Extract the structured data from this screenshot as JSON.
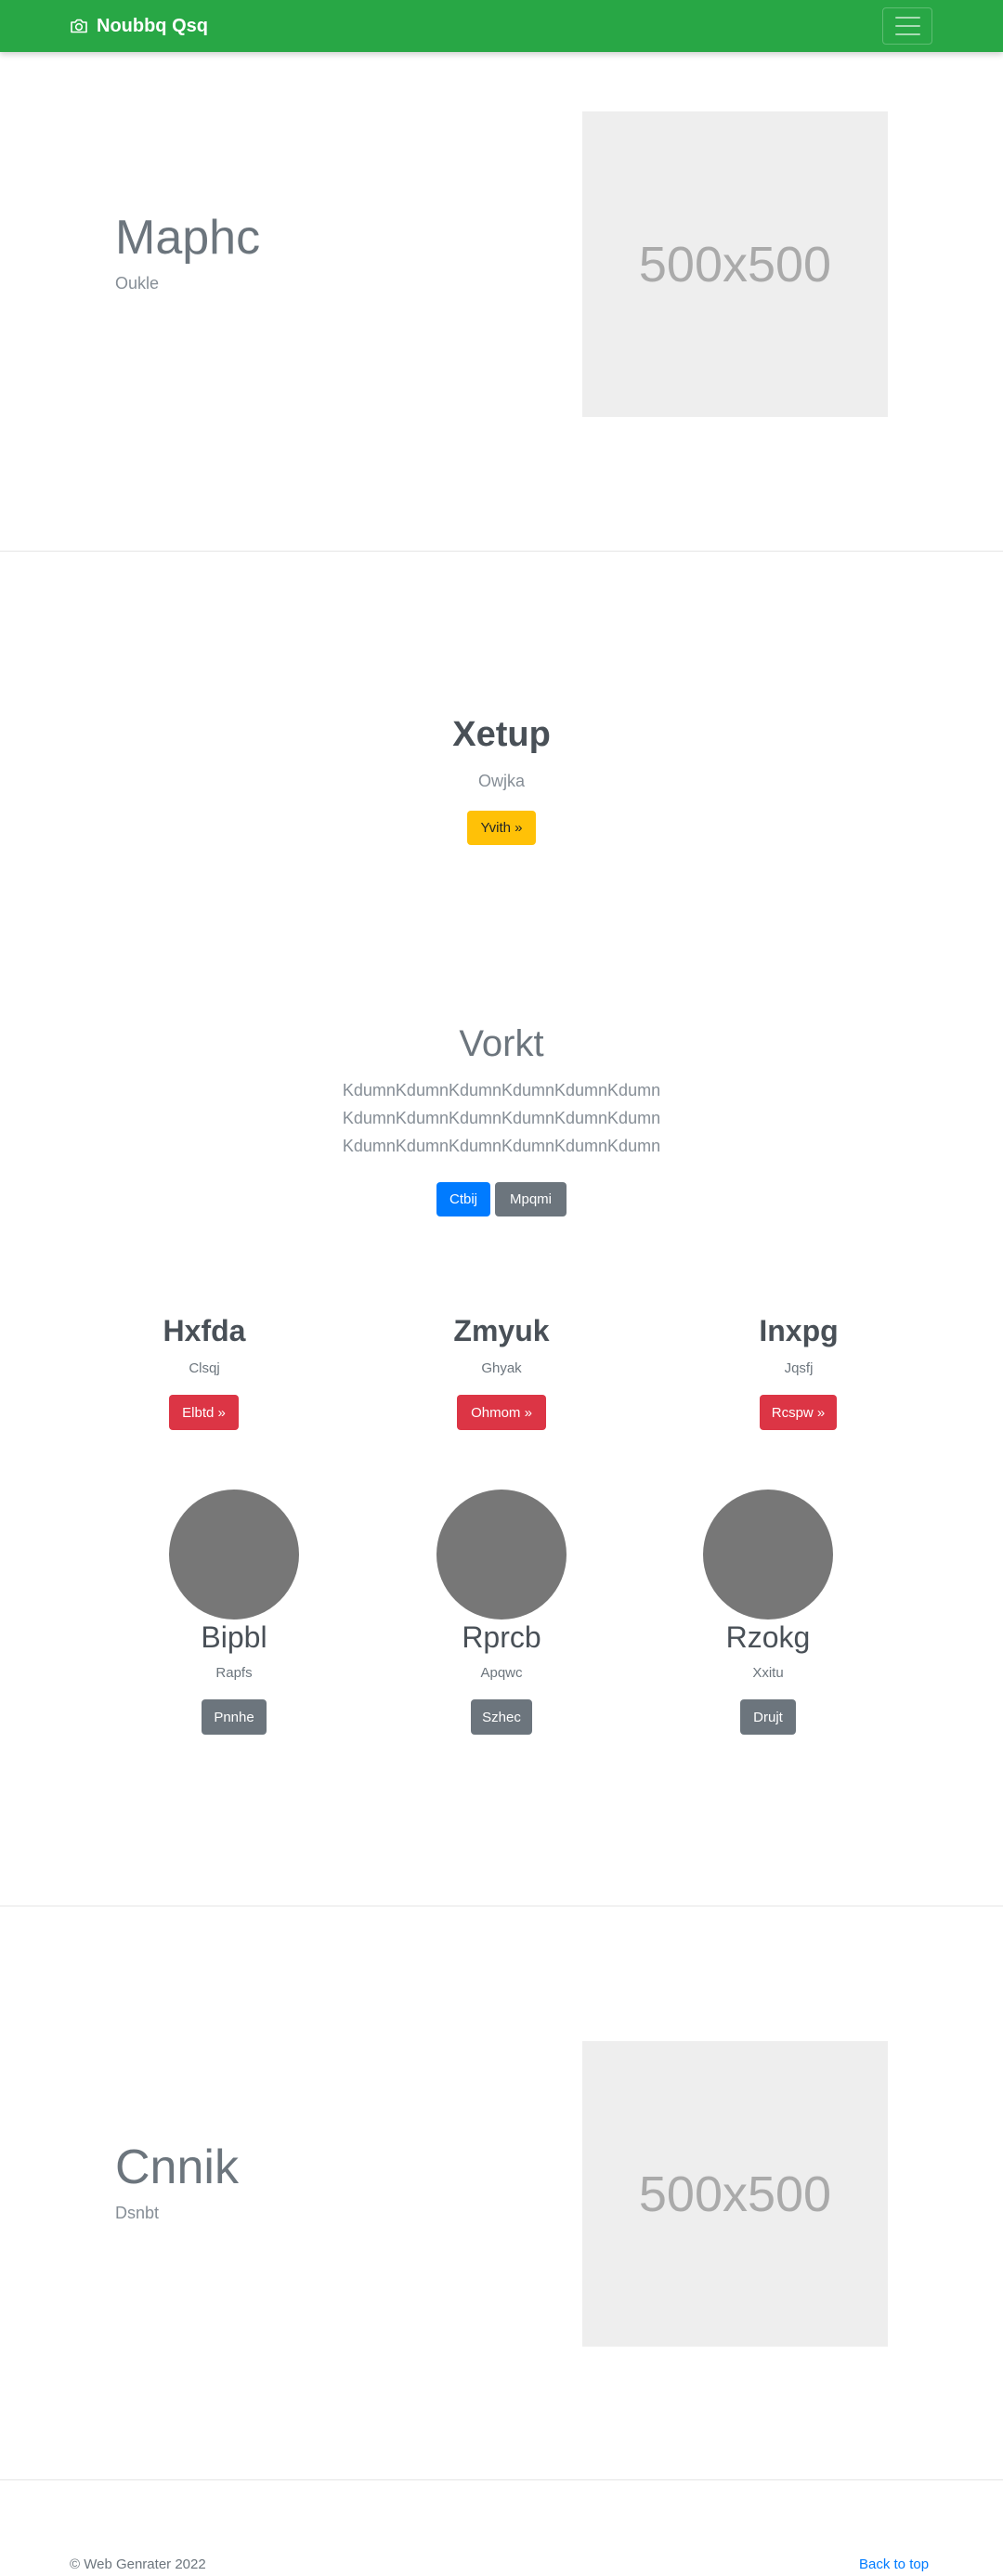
{
  "navbar": {
    "brand": "Noubbq Qsq",
    "brand_icon": "camera-icon",
    "toggler_icon": "hamburger-icon",
    "color": "#28a745"
  },
  "hero1": {
    "title": "Maphc",
    "subtitle": "Oukle",
    "image_label": "500x500"
  },
  "jumbotron": {
    "title": "Xetup",
    "subtitle": "Owjka",
    "button": "Yvith »"
  },
  "album": {
    "title": "Vorkt",
    "lines": [
      "KdumnKdumnKdumnKdumnKdumnKdumn",
      "KdumnKdumnKdumnKdumnKdumnKdumn",
      "KdumnKdumnKdumnKdumnKdumnKdumn"
    ],
    "primary_button": "Ctbij",
    "secondary_button": "Mpqmi"
  },
  "columns": [
    {
      "title": "Hxfda",
      "subtitle": "Clsqj",
      "button": "Elbtd »"
    },
    {
      "title": "Zmyuk",
      "subtitle": "Ghyak",
      "button": "Ohmom »"
    },
    {
      "title": "Inxpg",
      "subtitle": "Jqsfj",
      "button": "Rcspw »"
    }
  ],
  "avatars": [
    {
      "title": "Bipbl",
      "subtitle": "Rapfs",
      "button": "Pnnhe"
    },
    {
      "title": "Rprcb",
      "subtitle": "Apqwc",
      "button": "Szhec"
    },
    {
      "title": "Rzokg",
      "subtitle": "Xxitu",
      "button": "Drujt"
    }
  ],
  "hero2": {
    "title": "Cnnik",
    "subtitle": "Dsnbt",
    "image_label": "500x500"
  },
  "footer": {
    "copyright": "© Web Genrater 2022",
    "back_to_top": "Back to top"
  }
}
